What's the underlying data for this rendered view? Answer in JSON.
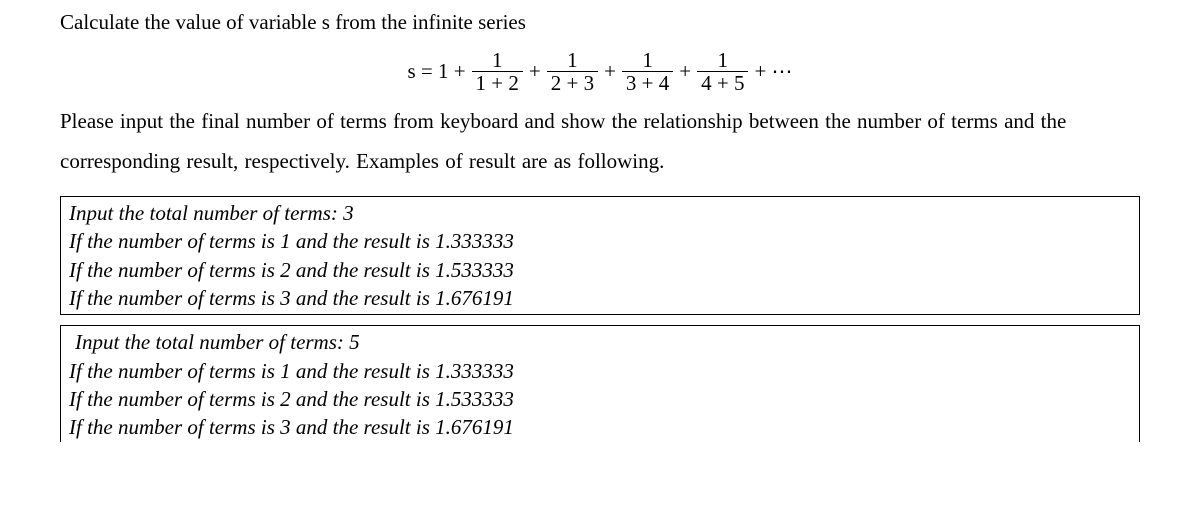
{
  "heading": "Calculate the value of variable s from the infinite series",
  "equation": {
    "lhs": "s = 1 +",
    "frac1_num": "1",
    "frac1_den": "1 + 2",
    "frac2_num": "1",
    "frac2_den": "2 + 3",
    "frac3_num": "1",
    "frac3_den": "3 + 4",
    "frac4_num": "1",
    "frac4_den": "4 + 5",
    "plus": "+",
    "tail": "+ ⋯"
  },
  "paragraph": "Please input the final number of terms from keyboard and show the relationship between the number of terms and the corresponding result, respectively. Examples of result are as following.",
  "example1": {
    "l1": "Input the total number of terms: 3",
    "l2": "If the number of terms is 1 and the result is 1.333333",
    "l3": "If the number of terms is 2 and the result is 1.533333",
    "l4": "If the number of terms is 3 and the result is 1.676191"
  },
  "example2": {
    "l1": " Input the total number of terms: 5",
    "l2": "If the number of terms is 1 and the result is 1.333333",
    "l3": "If the number of terms is 2 and the result is 1.533333",
    "l4": "If the number of terms is 3 and the result is 1.676191"
  }
}
